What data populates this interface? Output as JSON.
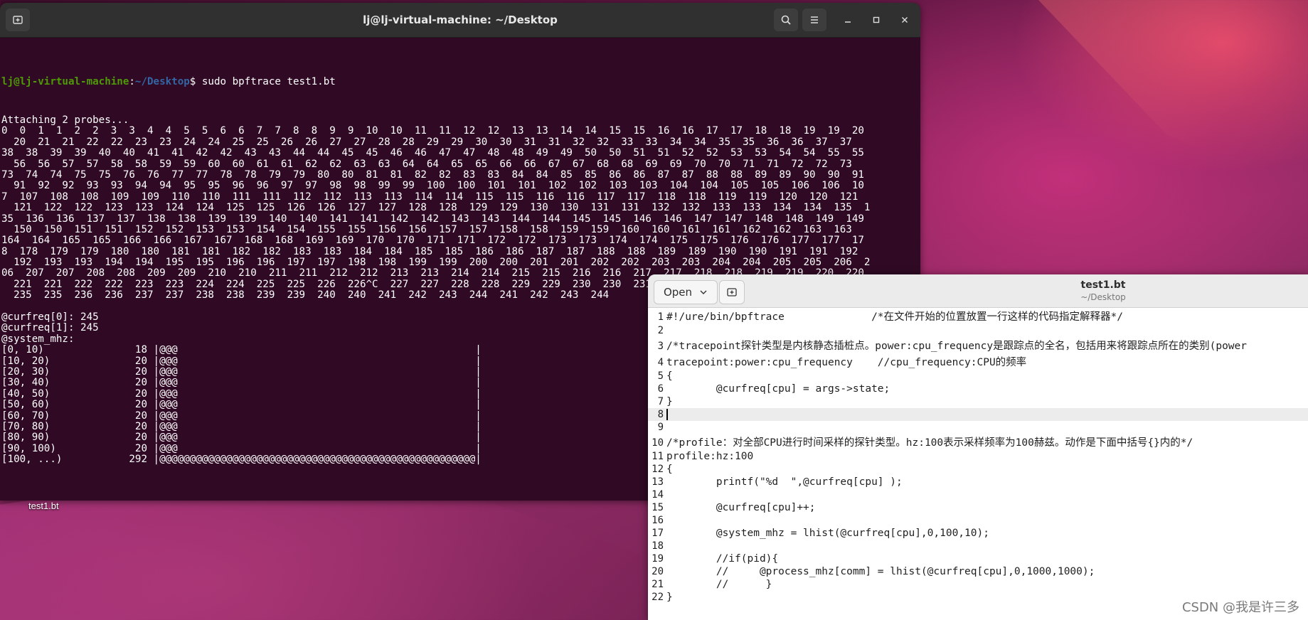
{
  "terminal": {
    "title": "lj@lj-virtual-machine: ~/Desktop",
    "prompt_user": "lj@lj-virtual-machine",
    "prompt_path": "~/Desktop",
    "command": "sudo bpftrace test1.bt",
    "output_lines": [
      "Attaching 2 probes...",
      "0  0  1  1  2  2  3  3  4  4  5  5  6  6  7  7  8  8  9  9  10  10  11  11  12  12  13  13  14  14  15  15  16  16  17  17  18  18  19  19  20",
      "  20  21  21  22  22  23  23  24  24  25  25  26  26  27  27  28  28  29  29  30  30  31  31  32  32  33  33  34  34  35  35  36  36  37  37",
      "38  38  39  39  40  40  41  41  42  42  43  43  44  44  45  45  46  46  47  47  48  48  49  49  50  50  51  51  52  52  53  53  54  54  55  55",
      "  56  56  57  57  58  58  59  59  60  60  61  61  62  62  63  63  64  64  65  65  66  66  67  67  68  68  69  69  70  70  71  71  72  72  73",
      "73  74  74  75  75  76  76  77  77  78  78  79  79  80  80  81  81  82  82  83  83  84  84  85  85  86  86  87  87  88  88  89  89  90  90  91",
      "  91  92  92  93  93  94  94  95  95  96  96  97  97  98  98  99  99  100  100  101  101  102  102  103  103  104  104  105  105  106  106  10",
      "7  107  108  108  109  109  110  110  111  111  112  112  113  113  114  114  115  115  116  116  117  117  118  118  119  119  120  120  121",
      "  121  122  122  123  123  124  124  125  125  126  126  127  127  128  128  129  129  130  130  131  131  132  132  133  133  134  134  135  1",
      "35  136  136  137  137  138  138  139  139  140  140  141  141  142  142  143  143  144  144  145  145  146  146  147  147  148  148  149  149",
      "  150  150  151  151  152  152  153  153  154  154  155  155  156  156  157  157  158  158  159  159  160  160  161  161  162  162  163  163",
      "164  164  165  165  166  166  167  167  168  168  169  169  170  170  171  171  172  172  173  173  174  174  175  175  176  176  177  177  17",
      "8  178  179  179  180  180  181  181  182  182  183  183  184  184  185  185  186  186  187  187  188  188  189  189  190  190  191  191  192",
      "  192  193  193  194  194  195  195  196  196  197  197  198  198  199  199  200  200  201  201  202  202  203  203  204  204  205  205  206  2",
      "06  207  207  208  208  209  209  210  210  211  211  212  212  213  213  214  214  215  215  216  216  217  217  218  218  219  219  220  220",
      "  221  221  222  222  223  223  224  224  225  225  226  226^C  227  227  228  228  229  229  230  230  231  231  232  232  233  233  234  234",
      "  235  235  236  236  237  237  238  238  239  239  240  240  241  242  243  244  241  242  243  244",
      "",
      "@curfreq[0]: 245",
      "@curfreq[1]: 245",
      "@system_mhz:",
      "[0, 10)               18 |@@@                                                 |",
      "[10, 20)              20 |@@@                                                 |",
      "[20, 30)              20 |@@@                                                 |",
      "[30, 40)              20 |@@@                                                 |",
      "[40, 50)              20 |@@@                                                 |",
      "[50, 60)              20 |@@@                                                 |",
      "[60, 70)              20 |@@@                                                 |",
      "[70, 80)              20 |@@@                                                 |",
      "[80, 90)              20 |@@@                                                 |",
      "[90, 100)             20 |@@@                                                 |",
      "[100, ...)           292 |@@@@@@@@@@@@@@@@@@@@@@@@@@@@@@@@@@@@@@@@@@@@@@@@@@@@|",
      ""
    ]
  },
  "desktop": {
    "file_label": "test1.bt"
  },
  "editor": {
    "open_label": "Open",
    "title": "test1.bt",
    "subtitle": "~/Desktop",
    "lines": [
      {
        "num": "1",
        "text": "#!/ure/bin/bpftrace              /*在文件开始的位置放置一行这样的代码指定解释器*/"
      },
      {
        "num": "2",
        "text": ""
      },
      {
        "num": "3",
        "text": "/*tracepoint探针类型是内核静态插桩点。power:cpu_frequency是跟踪点的全名，包括用来将跟踪点所在的类别(power"
      },
      {
        "num": "4",
        "text": "tracepoint:power:cpu_frequency    //cpu_frequency:CPU的频率"
      },
      {
        "num": "5",
        "text": "{"
      },
      {
        "num": "6",
        "text": "        @curfreq[cpu] = args->state;"
      },
      {
        "num": "7",
        "text": "}"
      },
      {
        "num": "8",
        "text": ""
      },
      {
        "num": "9",
        "text": ""
      },
      {
        "num": "10",
        "text": "/*profile：对全部CPU进行时间采样的探针类型。hz:100表示采样频率为100赫兹。动作是下面中括号{}内的*/"
      },
      {
        "num": "11",
        "text": "profile:hz:100"
      },
      {
        "num": "12",
        "text": "{"
      },
      {
        "num": "13",
        "text": "        printf(\"%d  \",@curfreq[cpu] );"
      },
      {
        "num": "14",
        "text": ""
      },
      {
        "num": "15",
        "text": "        @curfreq[cpu]++;"
      },
      {
        "num": "16",
        "text": ""
      },
      {
        "num": "17",
        "text": "        @system_mhz = lhist(@curfreq[cpu],0,100,10);"
      },
      {
        "num": "18",
        "text": ""
      },
      {
        "num": "19",
        "text": "        //if(pid){"
      },
      {
        "num": "20",
        "text": "        //     @process_mhz[comm] = lhist(@curfreq[cpu],0,1000,1000);"
      },
      {
        "num": "21",
        "text": "        //      }"
      },
      {
        "num": "22",
        "text": "}"
      }
    ]
  },
  "watermark": "CSDN @我是许三多",
  "icons": {
    "new_tab": "new-tab-icon",
    "search": "search-icon",
    "menu": "hamburger-menu-icon",
    "minimize": "minimize-icon",
    "maximize": "maximize-icon",
    "close": "close-icon",
    "dropdown": "chevron-down-icon"
  }
}
